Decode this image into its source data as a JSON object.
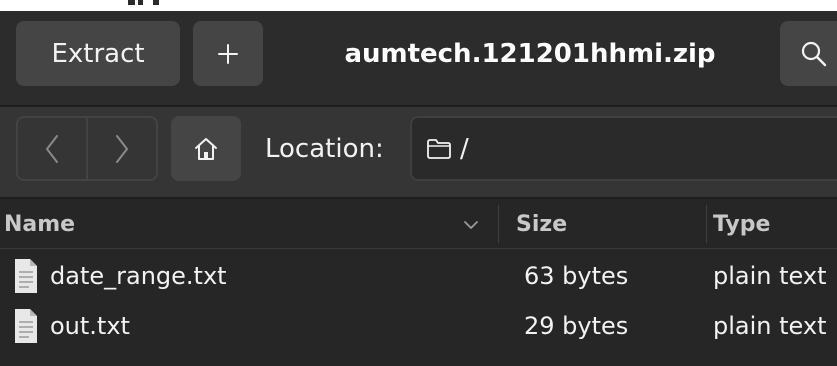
{
  "header": {
    "extract_label": "Extract",
    "title": "aumtech.121201hhmi.zip",
    "add_icon": "plus-icon",
    "search_icon": "search-icon"
  },
  "toolbar": {
    "back_icon": "chevron-left-icon",
    "forward_icon": "chevron-right-icon",
    "home_icon": "home-icon",
    "location_label": "Location:",
    "location_value": "/",
    "folder_icon": "folder-icon"
  },
  "file_list": {
    "columns": [
      {
        "label": "Name"
      },
      {
        "label": "Size"
      },
      {
        "label": "Type"
      }
    ],
    "rows": [
      {
        "name": "date_range.txt",
        "size": "63 bytes",
        "type": "plain text"
      },
      {
        "name": "out.txt",
        "size": "29 bytes",
        "type": "plain text"
      }
    ]
  },
  "colors": {
    "header_bg": "#2c2c2c",
    "toolbar_bg": "#353535",
    "list_bg": "#262626",
    "button_bg": "#454545",
    "text": "#f2f2f2"
  }
}
